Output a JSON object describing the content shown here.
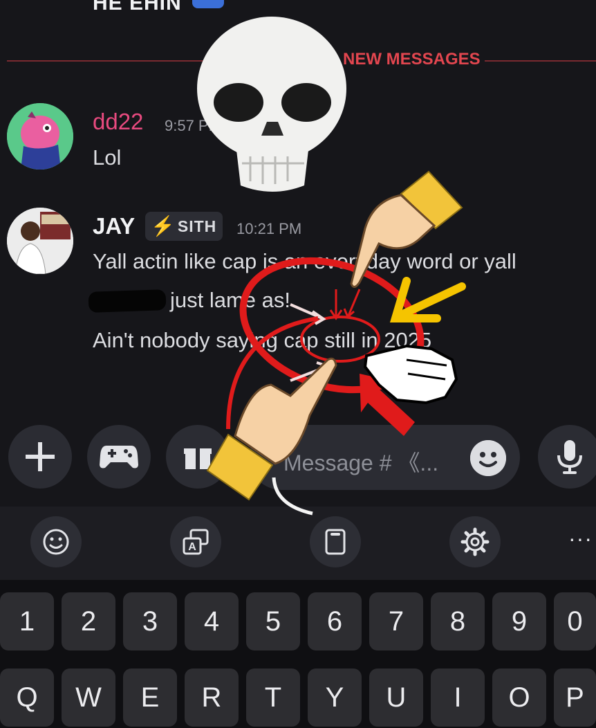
{
  "chat": {
    "previous_message": "HE EHIN",
    "new_messages_label": "NEW MESSAGES",
    "messages": [
      {
        "username": "dd22",
        "time": "9:57 PM",
        "lines": [
          "Lol"
        ]
      },
      {
        "username": "JAY",
        "tag": "SITH",
        "time": "10:21 PM",
        "lines": [
          "Yall actin like cap is an everyday word or yall",
          "just lame as!",
          "Ain't nobody saying cap still in 2025"
        ]
      }
    ]
  },
  "composer": {
    "plus_icon": "plus-icon",
    "game_icon": "gamepad-icon",
    "gift_icon": "gift-icon",
    "placeholder": "Message # 《...",
    "emoji_icon": "emoji-icon",
    "mic_icon": "microphone-icon"
  },
  "keyboard_toolbar": {
    "icons": [
      "emoji-icon",
      "translate-icon",
      "clipboard-icon",
      "gear-icon"
    ],
    "more": "···"
  },
  "keyboard": {
    "row1": [
      "1",
      "2",
      "3",
      "4",
      "5",
      "6",
      "7",
      "8",
      "9",
      "0"
    ],
    "row2": [
      "Q",
      "W",
      "E",
      "R",
      "T",
      "Y",
      "U",
      "I",
      "O",
      "P"
    ]
  },
  "colors": {
    "background": "#16161a",
    "username_pink": "#e84a7f",
    "new_messages_red": "#e2464f",
    "annotation_red": "#e01b1b",
    "annotation_yellow": "#f5c400"
  }
}
